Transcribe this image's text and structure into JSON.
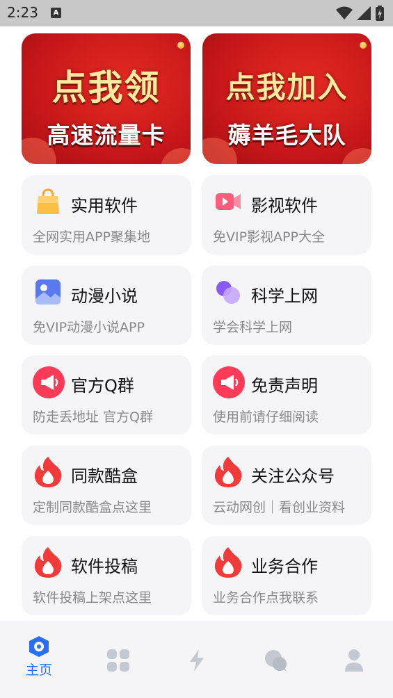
{
  "status": {
    "time": "2:23",
    "notif_letter": "A"
  },
  "banners": [
    {
      "line1": "点我领",
      "line2": "高速流量卡"
    },
    {
      "line1": "点我加入",
      "line2": "薅羊毛大队"
    }
  ],
  "cards": [
    {
      "title": "实用软件",
      "subtitle": "全网实用APP聚集地",
      "icon": "shopping-bag-icon"
    },
    {
      "title": "影视软件",
      "subtitle": "免VIP影视APP大全",
      "icon": "video-camera-icon"
    },
    {
      "title": "动漫小说",
      "subtitle": "免VIP动漫小说APP",
      "icon": "image-icon"
    },
    {
      "title": "科学上网",
      "subtitle": "学会科学上网",
      "icon": "circles-icon"
    },
    {
      "title": "官方Q群",
      "subtitle": "防走丢地址 官方Q群",
      "icon": "megaphone-icon"
    },
    {
      "title": "免责声明",
      "subtitle": "使用前请仔细阅读",
      "icon": "megaphone-icon"
    },
    {
      "title": "同款酷盒",
      "subtitle": "定制同款酷盒点这里",
      "icon": "flame-icon"
    },
    {
      "title": "关注公众号",
      "subtitle": "云动网创｜看创业资料",
      "icon": "flame-icon"
    },
    {
      "title": "软件投稿",
      "subtitle": "软件投稿上架点这里",
      "icon": "flame-icon"
    },
    {
      "title": "业务合作",
      "subtitle": "业务合作点我联系",
      "icon": "flame-icon"
    }
  ],
  "tabbar": {
    "home_label": "主页",
    "active_color": "#2b6df5",
    "inactive_color": "#c4c8d0"
  }
}
